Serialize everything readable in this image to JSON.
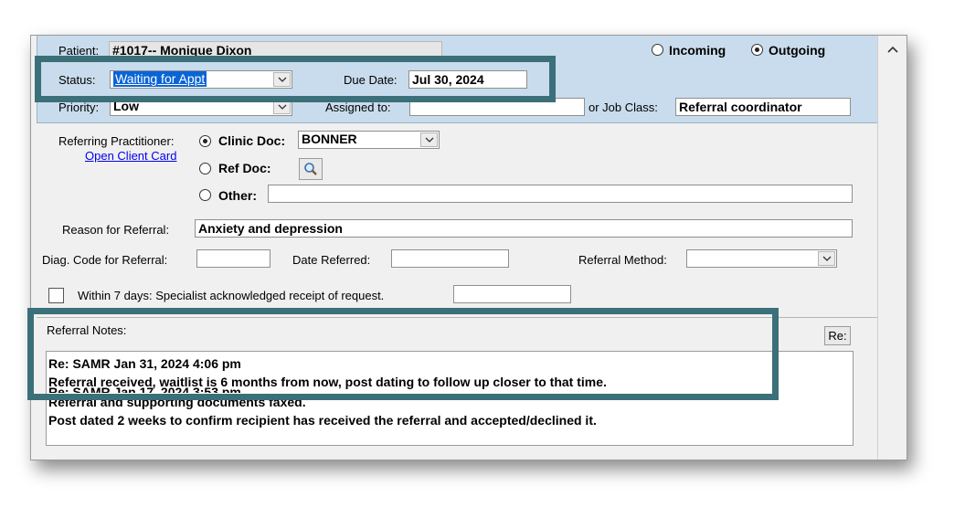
{
  "patient": {
    "label": "Patient:",
    "value": "#1017-- Monique Dixon"
  },
  "direction": {
    "incoming_label": "Incoming",
    "outgoing_label": "Outgoing",
    "selected": "Outgoing"
  },
  "status": {
    "label": "Status:",
    "value": "Waiting for Appt"
  },
  "due_date": {
    "label": "Due Date:",
    "value": "Jul 30, 2024"
  },
  "priority": {
    "label": "Priority:",
    "value": "Low"
  },
  "assigned_to": {
    "label": "Assigned to:",
    "value": ""
  },
  "job_class": {
    "label": "or Job Class:",
    "value": "Referral coordinator"
  },
  "referring_practitioner": {
    "label": "Referring Practitioner:",
    "open_client_card": "Open Client Card",
    "clinic_doc_label": "Clinic Doc:",
    "clinic_doc_value": "BONNER",
    "ref_doc_label": "Ref Doc:",
    "other_label": "Other:",
    "other_value": "",
    "selected": "Clinic Doc"
  },
  "reason": {
    "label": "Reason for Referral:",
    "value": "Anxiety and depression"
  },
  "diag_code": {
    "label": "Diag. Code for Referral:",
    "value": ""
  },
  "date_referred": {
    "label": "Date Referred:",
    "value": ""
  },
  "referral_method": {
    "label": "Referral Method:",
    "value": ""
  },
  "acknowledged": {
    "label": "Within 7 days: Specialist acknowledged receipt of request.",
    "checked": false,
    "value": ""
  },
  "notes": {
    "label": "Referral Notes:",
    "re_button": "Re:",
    "lines": [
      "Re: SAMR Jan 31, 2024  4:06 pm",
      "Referral received, waitlist is 6 months from now, post dating to follow up closer to that time.",
      "Re: SAMR Jan 17, 2024  3:53 pm",
      "Referral and supporting documents faxed.",
      "Post dated 2 weeks to confirm recipient has received the referral and accepted/declined it."
    ]
  },
  "colors": {
    "header_band": "#c9dced",
    "callout": "#3b6f79",
    "selection": "#0a64d6",
    "link": "#0000ee"
  },
  "icons": {
    "scroll_up": "chevron-up-icon",
    "dropdown": "chevron-down-icon",
    "lookup": "magnifier-icon"
  }
}
